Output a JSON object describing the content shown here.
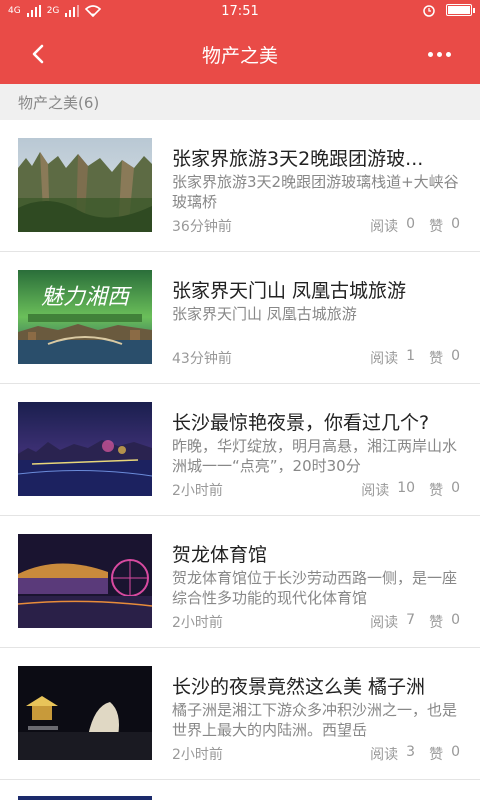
{
  "status_bar": {
    "signal_1": "4G",
    "signal_2": "2G",
    "time": "17:51",
    "battery_level": 0.9
  },
  "nav": {
    "title": "物产之美"
  },
  "section": {
    "label": "物产之美(6)"
  },
  "stats_labels": {
    "read": "阅读",
    "like": "赞"
  },
  "articles": [
    {
      "title": "张家界旅游3天2晚跟团游玻...",
      "desc": "张家界旅游3天2晚跟团游玻璃栈道+大峡谷玻璃桥",
      "time": "36分钟前",
      "reads": "0",
      "likes": "0"
    },
    {
      "title": "张家界天门山 凤凰古城旅游",
      "desc": "张家界天门山 凤凰古城旅游",
      "time": "43分钟前",
      "reads": "1",
      "likes": "0",
      "image_text": "魅力湘西"
    },
    {
      "title": "长沙最惊艳夜景，你看过几个?",
      "desc": "昨晚，华灯绽放，明月高悬，湘江两岸山水洲城一一“点亮”，20时30分",
      "time": "2小时前",
      "reads": "10",
      "likes": "0"
    },
    {
      "title": "贺龙体育馆",
      "desc": "贺龙体育馆位于长沙劳动西路一侧，是一座综合性多功能的现代化体育馆",
      "time": "2小时前",
      "reads": "7",
      "likes": "0"
    },
    {
      "title": "长沙的夜景竟然这么美 橘子洲",
      "desc": "橘子洲是湘江下游众多冲积沙洲之一，也是世界上最大的内陆洲。西望岳",
      "time": "2小时前",
      "reads": "3",
      "likes": "0"
    }
  ]
}
